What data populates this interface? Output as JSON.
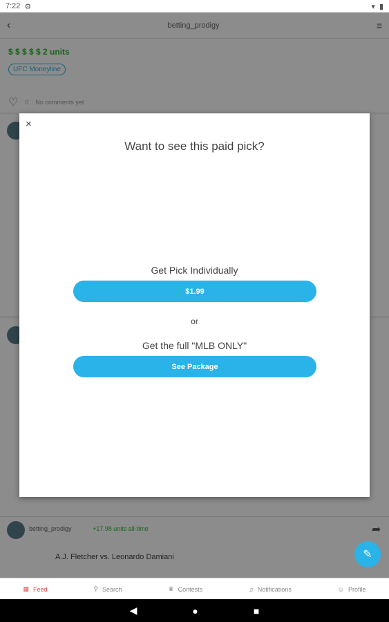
{
  "status_bar": {
    "time": "7:22",
    "icons": [
      "gear-icon",
      "wifi-icon",
      "battery-icon"
    ]
  },
  "app_bar": {
    "title": "betting_prodigy"
  },
  "background": {
    "first_card": {
      "money": "$ $ $ $ $  2 units",
      "chip": "UFC Moneyline",
      "likes": "0",
      "comments": "No comments yet"
    },
    "bottom_card": {
      "user": "betting_prodigy",
      "units": "+17.98 units all-time",
      "matchup": "A.J. Fletcher vs. Leonardo Damiani"
    }
  },
  "modal": {
    "close_label": "×",
    "heading": "Want to see this paid pick?",
    "individual_label": "Get Pick Individually",
    "price_button": "$1.99",
    "or_label": "or",
    "package_label": "Get the full \"MLB ONLY\"",
    "package_button": "See Package"
  },
  "bottom_nav": [
    {
      "label": "Feed",
      "icon": "feed-icon"
    },
    {
      "label": "Search",
      "icon": "search-icon"
    },
    {
      "label": "Contests",
      "icon": "trophy-icon"
    },
    {
      "label": "Notifications",
      "icon": "bell-icon"
    },
    {
      "label": "Profile",
      "icon": "profile-icon"
    }
  ],
  "system_nav": {
    "back": "◀",
    "home": "●",
    "recents": "■"
  }
}
